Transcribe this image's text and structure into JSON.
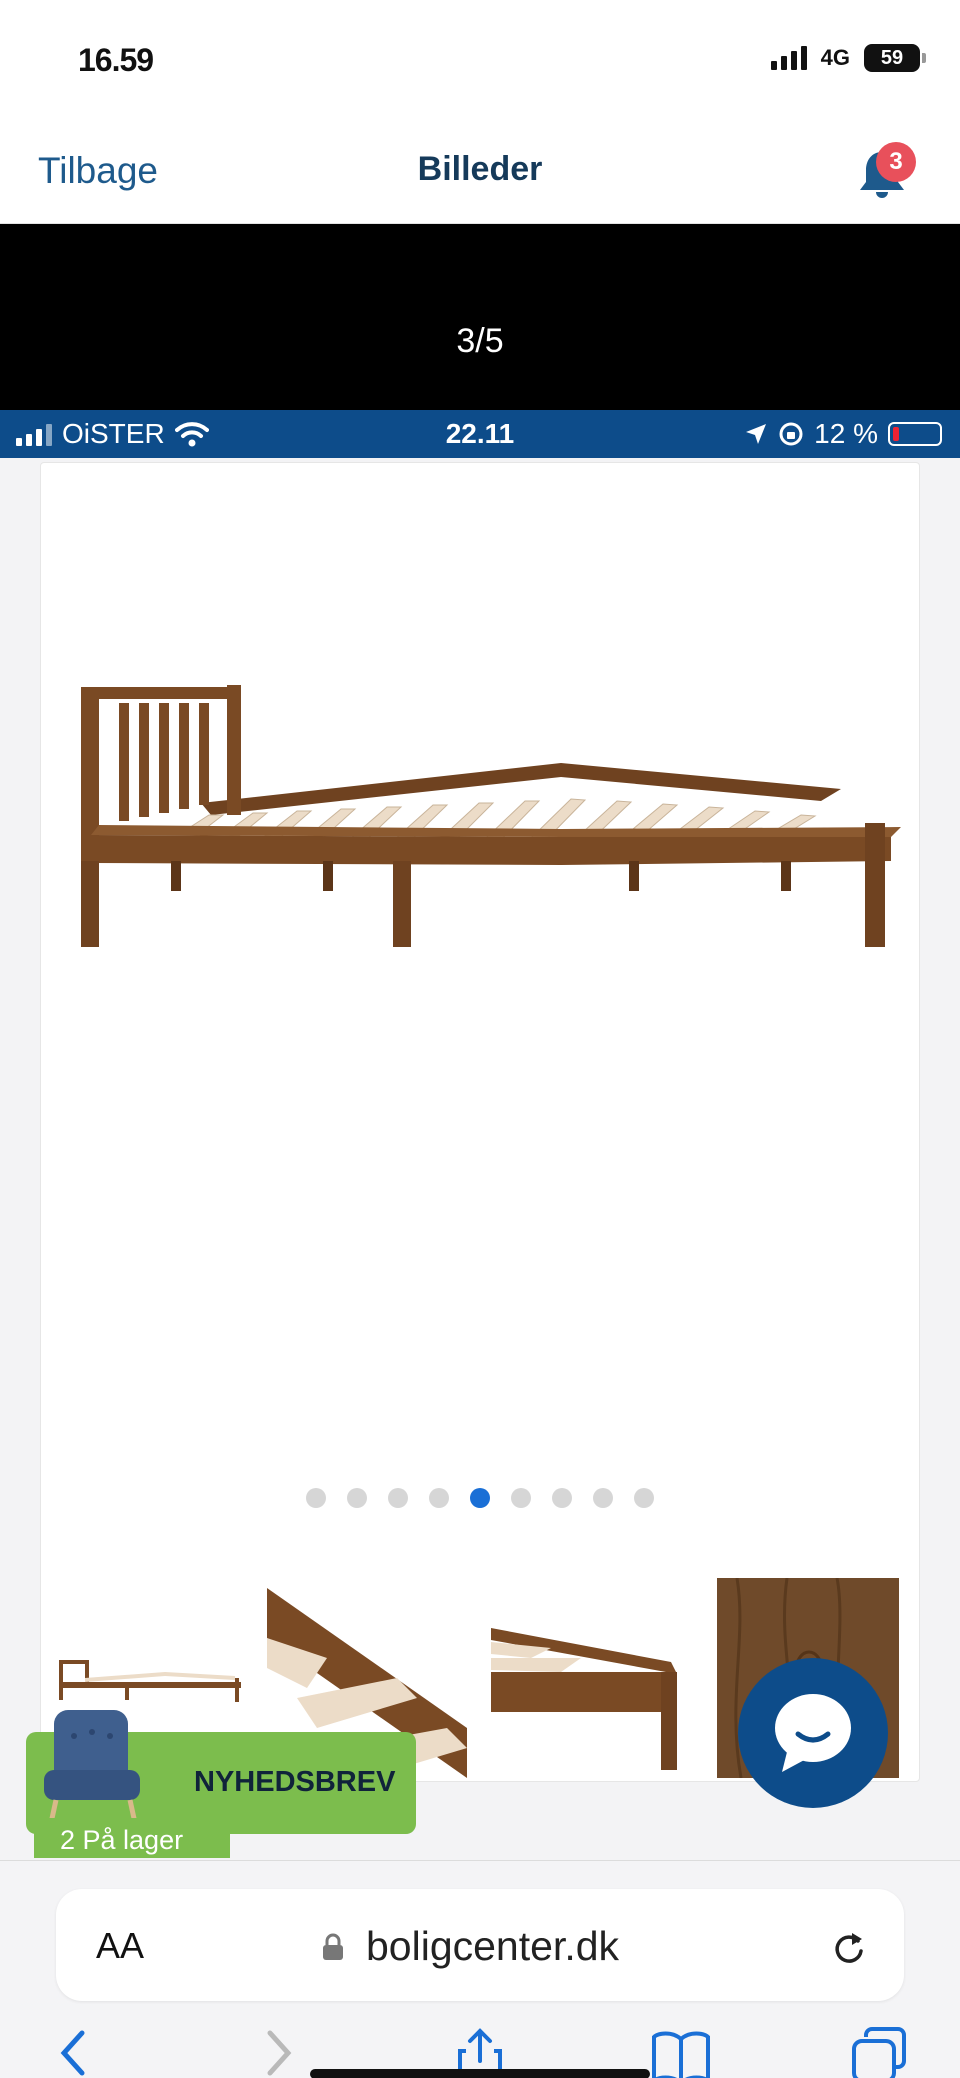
{
  "outer_status": {
    "time": "16.59",
    "network": "4G",
    "battery": "59"
  },
  "header": {
    "back_label": "Tilbage",
    "title": "Billeder",
    "notification_count": "3"
  },
  "viewer": {
    "counter": "3/5"
  },
  "inner_status": {
    "carrier": "OiSTER",
    "time": "22.11",
    "battery": "12 %"
  },
  "gallery": {
    "dot_count": 9,
    "active_dot": 4
  },
  "newsletter": {
    "label": "NYHEDSBREV",
    "stock_label": "2 På lager"
  },
  "browser": {
    "aa_label": "AA",
    "url": "boligcenter.dk"
  },
  "colors": {
    "accent": "#0d4c8a",
    "green": "#7cbd4d",
    "wood": "#7a4a24",
    "slat": "#ecdcc8"
  }
}
